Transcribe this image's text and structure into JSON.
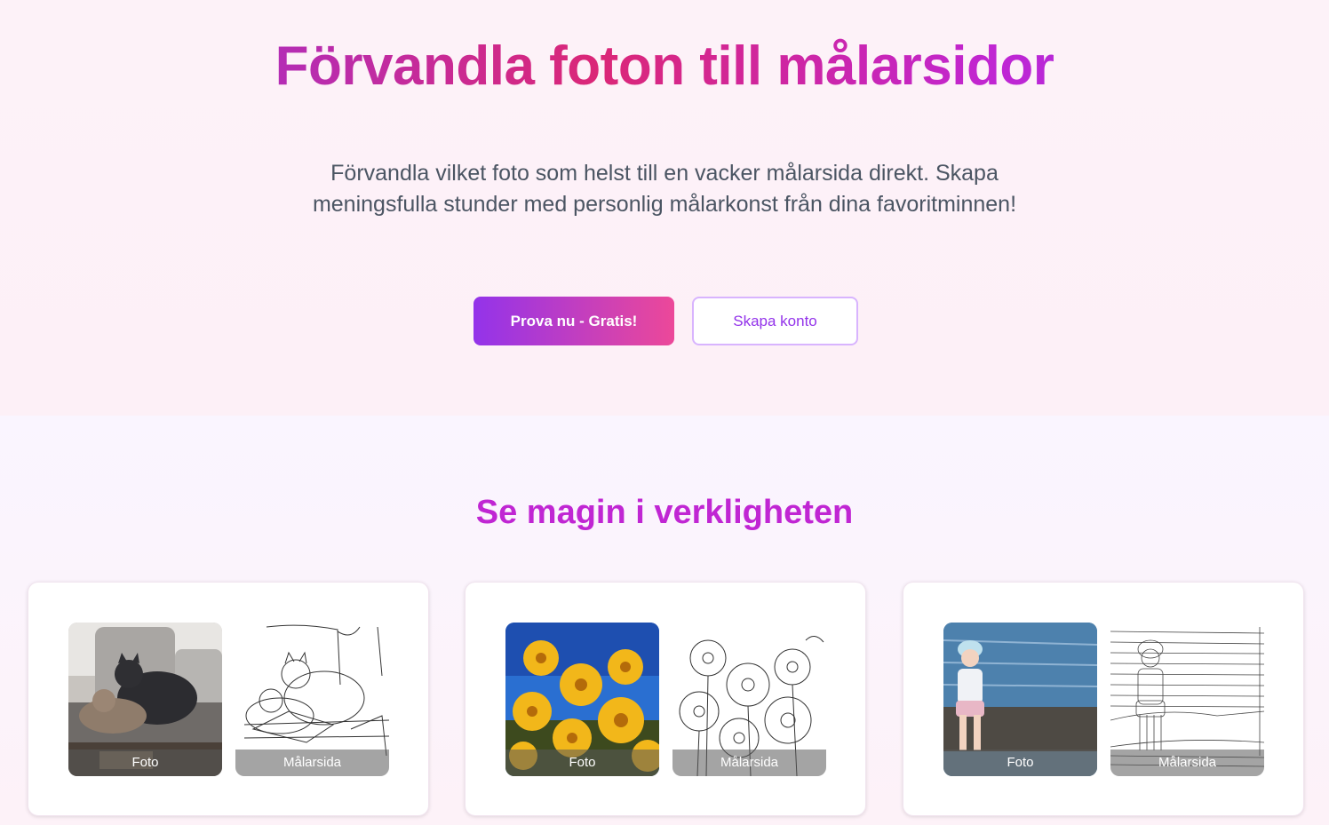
{
  "hero": {
    "title": "Förvandla foton till målarsidor",
    "subtitle": "Förvandla vilket foto som helst till en vacker målarsida direkt. Skapa meningsfulla stunder med personlig målarkonst från dina favoritminnen!",
    "primary_button": "Prova nu - Gratis!",
    "secondary_button": "Skapa konto"
  },
  "examples": {
    "title": "Se magin i verkligheten",
    "cards": [
      {
        "photo_label": "Foto",
        "coloring_label": "Målarsida",
        "subject": "cats"
      },
      {
        "photo_label": "Foto",
        "coloring_label": "Målarsida",
        "subject": "flowers"
      },
      {
        "photo_label": "Foto",
        "coloring_label": "Målarsida",
        "subject": "child-by-water"
      }
    ]
  },
  "colors": {
    "brand_purple": "#9333ea",
    "brand_pink": "#ec4899",
    "text_gray": "#4b5563"
  }
}
